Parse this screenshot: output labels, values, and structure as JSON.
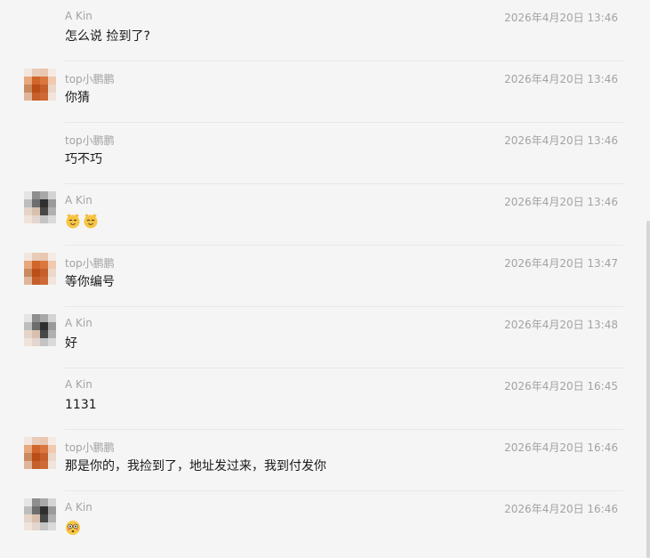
{
  "messages": [
    {
      "sender": "A Kin",
      "time": "2026年4月20日 13:46",
      "text": "怎么说 捡到了?",
      "avatar": "none"
    },
    {
      "sender": "top小鹏鹏",
      "time": "2026年4月20日 13:46",
      "text": "你猜",
      "avatar": "orange-pixel-avatar"
    },
    {
      "sender": "top小鹏鹏",
      "time": "2026年4月20日 13:46",
      "text": "巧不巧",
      "avatar": "none"
    },
    {
      "sender": "A Kin",
      "time": "2026年4月20日 13:46",
      "text": "",
      "emojis": [
        "cat-face-emoji",
        "cat-face-emoji"
      ],
      "avatar": "gray-pixel-avatar"
    },
    {
      "sender": "top小鹏鹏",
      "time": "2026年4月20日 13:47",
      "text": "等你编号",
      "avatar": "orange-pixel-avatar"
    },
    {
      "sender": "A Kin",
      "time": "2026年4月20日 13:48",
      "text": "好",
      "avatar": "gray-pixel-avatar"
    },
    {
      "sender": "A Kin",
      "time": "2026年4月20日 16:45",
      "text": "1131",
      "avatar": "none"
    },
    {
      "sender": "top小鹏鹏",
      "time": "2026年4月20日 16:46",
      "text": "那是你的，我捡到了，地址发过来，我到付发你",
      "avatar": "orange-pixel-avatar"
    },
    {
      "sender": "A Kin",
      "time": "2026年4月20日 16:46",
      "text": "",
      "emojis": [
        "flushed-face-emoji"
      ],
      "avatar": "gray-pixel-avatar"
    }
  ],
  "colors": {
    "background": "#f5f5f5",
    "name_time": "#a3a3a3",
    "text": "#191919",
    "divider": "#e7e7e7"
  }
}
